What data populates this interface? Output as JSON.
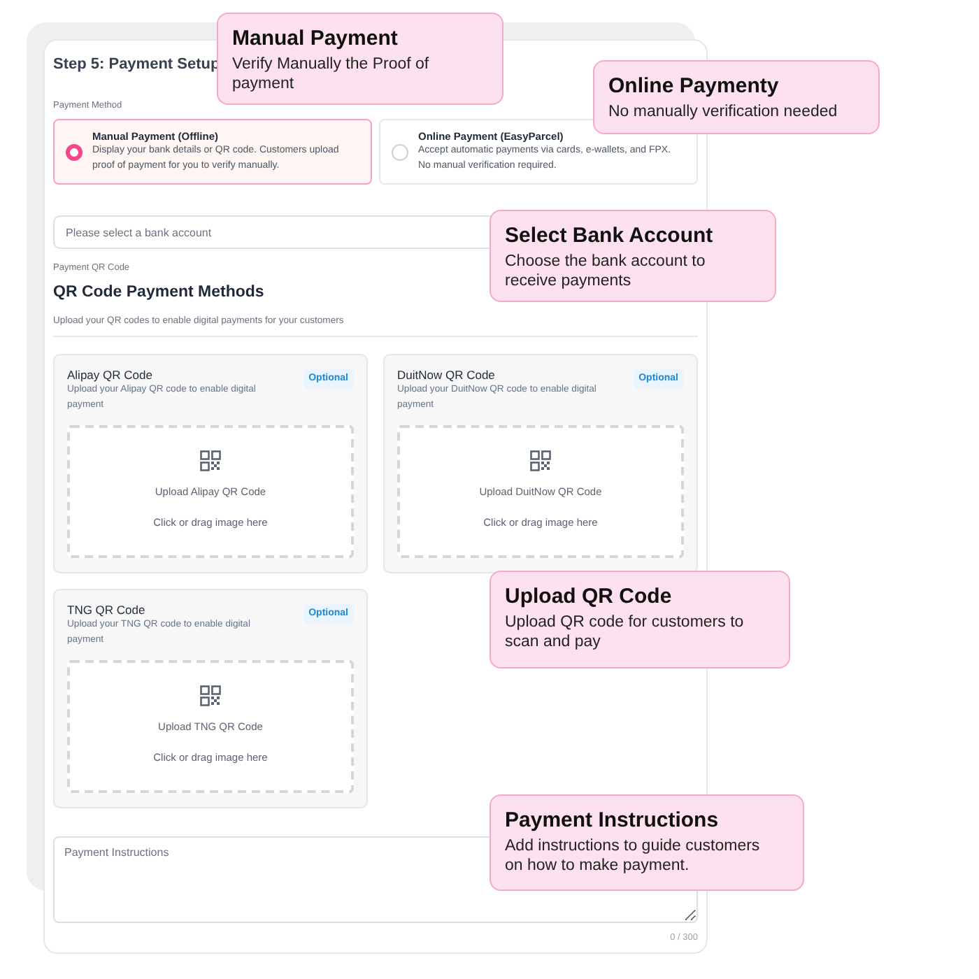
{
  "form": {
    "title": "Step 5: Payment Setup",
    "payment_method": {
      "label": "Payment Method",
      "options": [
        {
          "title": "Manual Payment (Offline)",
          "description": "Display your bank details or QR code. Customers upload proof of payment for you to verify manually.",
          "selected": true
        },
        {
          "title": "Online Payment (EasyParcel)",
          "description": "Accept automatic payments via cards, e-wallets, and FPX. No manual verification required.",
          "selected": false
        }
      ]
    },
    "bank_account": {
      "placeholder": "Please select a bank account"
    },
    "qr_section": {
      "label": "Payment QR Code",
      "heading": "QR Code Payment Methods",
      "description": "Upload your QR codes to enable digital payments for your customers",
      "cards": [
        {
          "title": "Alipay QR Code",
          "description": "Upload your Alipay QR code to enable digital payment",
          "badge": "Optional",
          "upload_label": "Upload Alipay QR Code",
          "upload_hint": "Click or drag image here"
        },
        {
          "title": "DuitNow QR Code",
          "description": "Upload your DuitNow QR code to enable digital payment",
          "badge": "Optional",
          "upload_label": "Upload DuitNow QR Code",
          "upload_hint": "Click or drag image here"
        },
        {
          "title": "TNG QR Code",
          "description": "Upload your TNG QR code to enable digital payment",
          "badge": "Optional",
          "upload_label": "Upload TNG QR Code",
          "upload_hint": "Click or drag image here"
        }
      ]
    },
    "instructions": {
      "placeholder": "Payment Instructions",
      "counter": "0 / 300"
    }
  },
  "callouts": [
    {
      "title": "Manual Payment",
      "text": "Verify Manually the Proof of payment"
    },
    {
      "title": "Online Paymenty",
      "text": "No manually verification needed"
    },
    {
      "title": "Select Bank Account",
      "text": "Choose the bank account to receive payments"
    },
    {
      "title": "Upload QR Code",
      "text": "Upload QR code for customers to scan and pay"
    },
    {
      "title": "Payment Instructions",
      "text": "Add instructions to guide customers on how to make payment."
    }
  ]
}
